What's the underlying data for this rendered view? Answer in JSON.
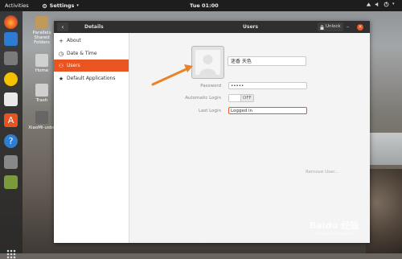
{
  "topbar": {
    "activities": "Activities",
    "app_name": "Settings",
    "app_menu_icon": "chevron-down-icon",
    "clock": "Tue 01:00"
  },
  "desktop_icons": [
    {
      "label": "Parallels Shared Folders",
      "icon": "folder-icon"
    },
    {
      "label": "Home",
      "icon": "home-folder-icon"
    },
    {
      "label": "Trash",
      "icon": "trash-icon"
    },
    {
      "label": "XiaoMi-usbo",
      "icon": "usb-drive-icon"
    }
  ],
  "window": {
    "left_title": "Details",
    "center_title": "Users",
    "unlock_label": "Unlock",
    "back_icon": "back-arrow-icon",
    "minimize_icon": "minimize-icon",
    "close_icon": "close-icon"
  },
  "sidebar": {
    "items": [
      {
        "label": "About",
        "icon": "plus-icon",
        "active": false
      },
      {
        "label": "Date & Time",
        "icon": "clock-icon",
        "active": false
      },
      {
        "label": "Users",
        "icon": "users-icon",
        "active": true
      },
      {
        "label": "Default Applications",
        "icon": "star-icon",
        "active": false
      }
    ]
  },
  "user": {
    "name": "迷香 天色",
    "password_label": "Password",
    "password_value": "•••••",
    "auto_login_label": "Automatic Login",
    "auto_login_state": "OFF",
    "last_login_label": "Last Login",
    "last_login_value": "Logged in",
    "remove_label": "Remove User..."
  },
  "watermark": {
    "text": "Baidu 经验",
    "sub": "jingyan.baidu.com"
  },
  "colors": {
    "accent": "#e95420",
    "titlebar": "#2f2f2f",
    "arrow": "#e8832a"
  }
}
